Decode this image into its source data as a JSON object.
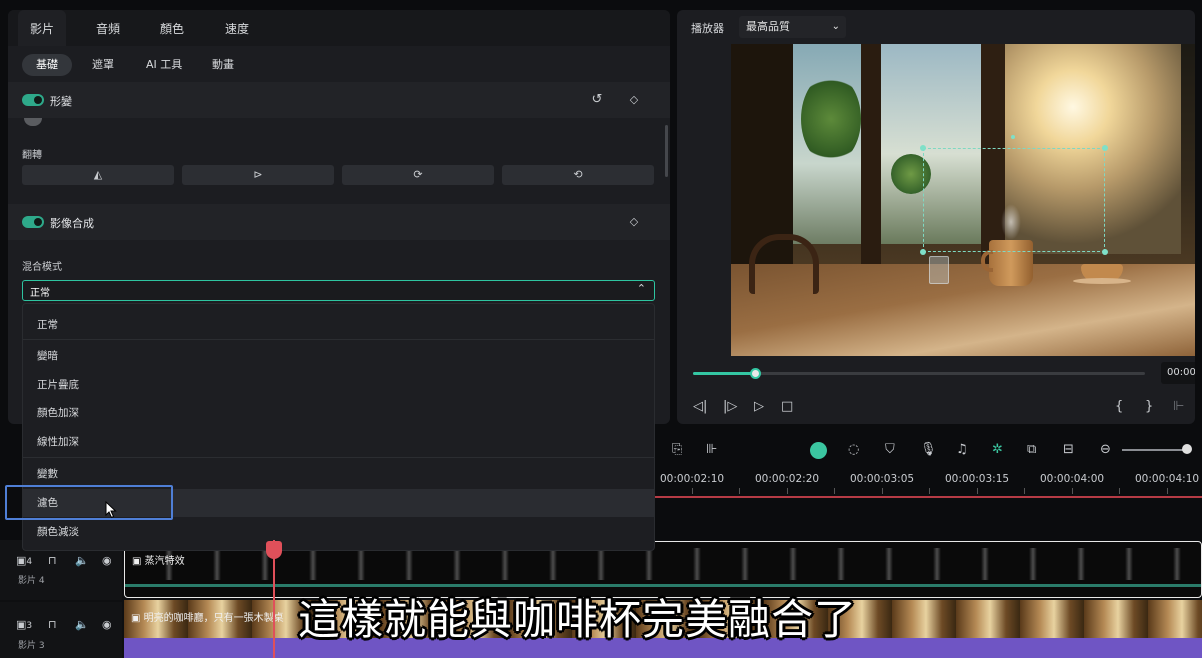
{
  "left_panel": {
    "main_tabs": [
      {
        "label": "影片",
        "active": true
      },
      {
        "label": "音頻",
        "active": false
      },
      {
        "label": "顏色",
        "active": false
      },
      {
        "label": "速度",
        "active": false
      }
    ],
    "sub_tabs": [
      {
        "label": "基礎",
        "active": true
      },
      {
        "label": "遮罩",
        "active": false
      },
      {
        "label": "AI 工具",
        "active": false
      },
      {
        "label": "動畫",
        "active": false
      }
    ],
    "transform": {
      "title": "形變",
      "enabled": true,
      "reset_icon": "reset-icon",
      "keyframe_icon": "keyframe-diamond-icon"
    },
    "flip": {
      "label": "翻轉",
      "buttons": [
        "flip-horizontal-icon",
        "flip-vertical-icon",
        "rotate-right-icon",
        "rotate-left-icon"
      ]
    },
    "compositing": {
      "title": "影像合成",
      "enabled": true,
      "keyframe_icon": "keyframe-diamond-icon"
    },
    "blend_mode": {
      "label": "混合模式",
      "selected": "正常",
      "options": [
        "正常",
        "變暗",
        "正片疊底",
        "顏色加深",
        "線性加深",
        "變數",
        "濾色",
        "顏色減淡"
      ],
      "hovered": "濾色"
    }
  },
  "player": {
    "label": "播放器",
    "quality": "最高品質",
    "progress": 0.14,
    "time": "00:00",
    "controls": [
      "prev-frame-icon",
      "next-frame-icon",
      "play-icon",
      "stop-icon",
      "mark-in-icon",
      "mark-out-icon",
      "more-icon"
    ]
  },
  "timeline": {
    "ruler_labels": [
      "00:00:02:10",
      "00:00:02:20",
      "00:00:03:05",
      "00:00:03:15",
      "00:00:04:00",
      "00:00:04:10"
    ],
    "tracks": [
      {
        "name": "影片 4",
        "number": "4",
        "clip_title": "蒸汽特效"
      },
      {
        "name": "影片 3",
        "number": "3",
        "clip_title": "明亮的咖啡廳，只有一張木製桌"
      }
    ]
  },
  "subtitle": "這樣就能與咖啡杯完美融合了",
  "colors": {
    "accent": "#34c7a3",
    "playhead": "#e0505a",
    "highlight": "#4f7fd6",
    "purple_track": "#6f55c4"
  }
}
